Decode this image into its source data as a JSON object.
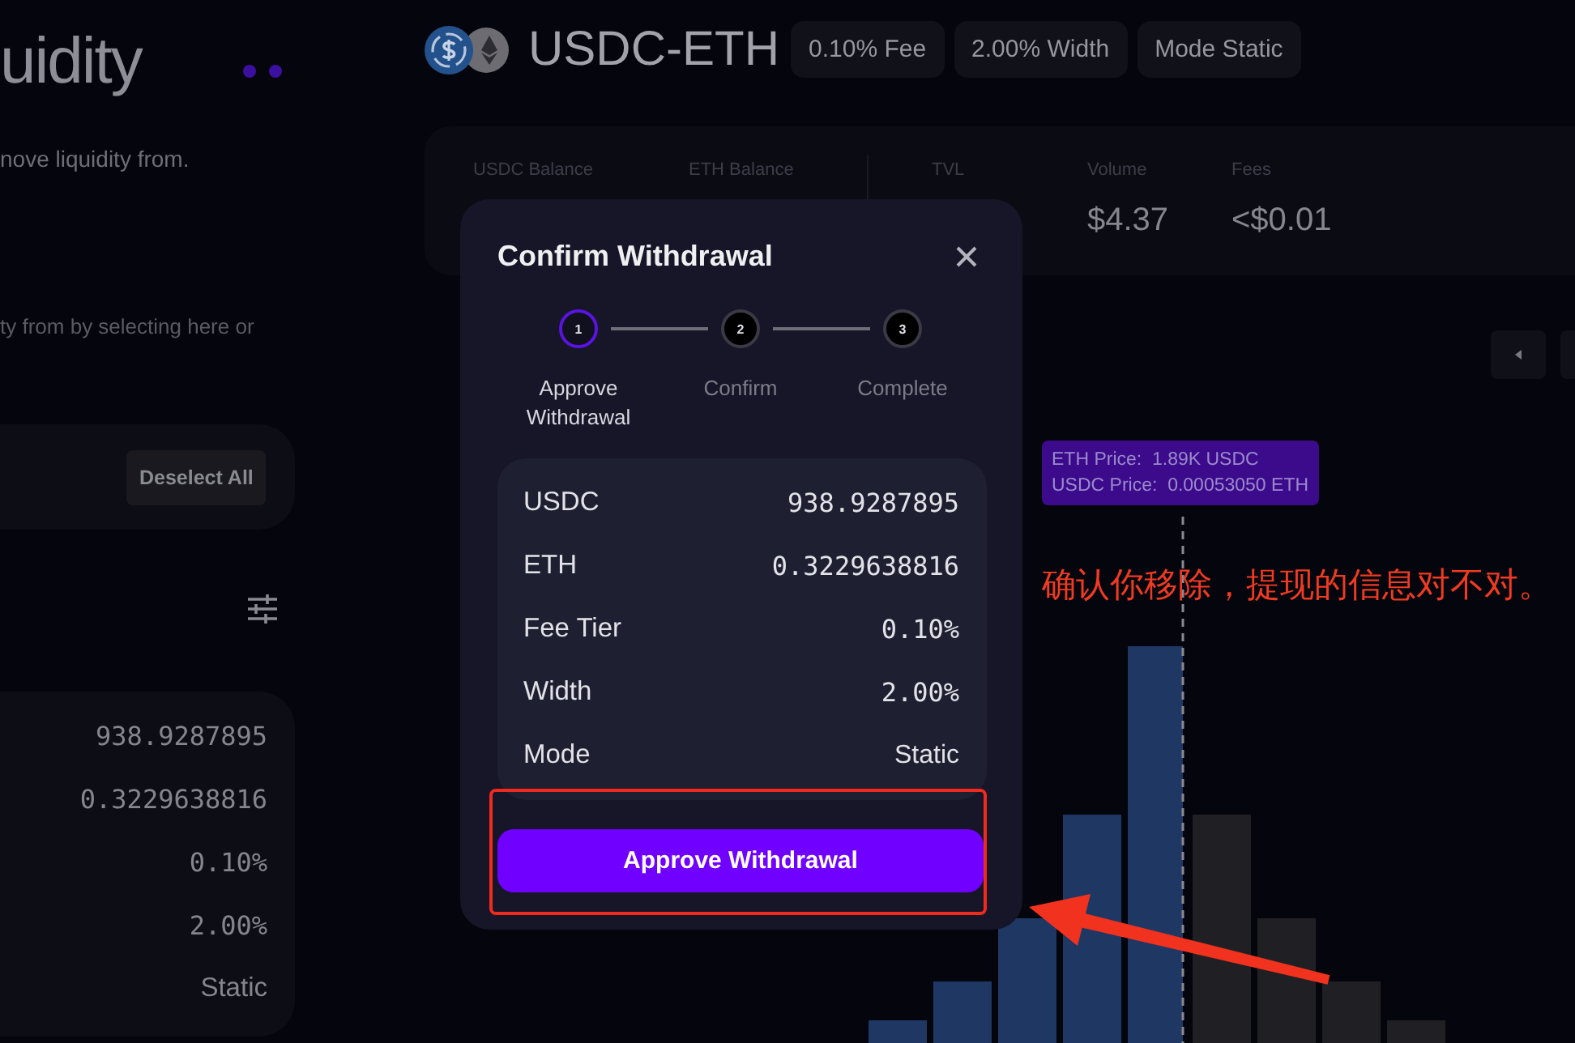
{
  "left_panel": {
    "title": "uidity",
    "subtitle": "nove liquidity from.",
    "hint": "ty from by selecting here or",
    "deselect_button": "Deselect All",
    "values": [
      {
        "value": "938.9287895",
        "kind": "number"
      },
      {
        "value": "0.3229638816",
        "kind": "number"
      },
      {
        "value": "0.10%",
        "kind": "number"
      },
      {
        "value": "2.00%",
        "kind": "number"
      },
      {
        "value": "Static",
        "kind": "text"
      }
    ]
  },
  "pool": {
    "name": "USDC-ETH",
    "chips": [
      "0.10% Fee",
      "2.00% Width",
      "Mode Static"
    ]
  },
  "stats": {
    "balances": [
      {
        "label": "USDC Balance"
      },
      {
        "label": "ETH Balance"
      }
    ],
    "metrics": [
      {
        "label": "TVL"
      },
      {
        "label": "Volume",
        "value": "$4.37"
      },
      {
        "label": "Fees",
        "value": "<$0.01"
      }
    ]
  },
  "chart": {
    "tooltip": [
      "ETH Price:  1.89K USDC",
      "USDC Price:  0.00053050 ETH"
    ]
  },
  "modal": {
    "title": "Confirm Withdrawal",
    "steps": [
      {
        "number": "1",
        "label": "Approve Withdrawal",
        "selected": true
      },
      {
        "number": "2",
        "label": "Confirm",
        "selected": false
      },
      {
        "number": "3",
        "label": "Complete",
        "selected": false
      }
    ],
    "details": [
      {
        "label": "USDC",
        "value": "938.9287895",
        "kind": "number"
      },
      {
        "label": "ETH",
        "value": "0.3229638816",
        "kind": "number"
      },
      {
        "label": "Fee Tier",
        "value": "0.10%",
        "kind": "number"
      },
      {
        "label": "Width",
        "value": "2.00%",
        "kind": "number"
      },
      {
        "label": "Mode",
        "value": "Static",
        "kind": "text"
      }
    ],
    "button": "Approve Withdrawal"
  },
  "annotation": {
    "note": "确认你移除，提现的信息对不对。"
  }
}
